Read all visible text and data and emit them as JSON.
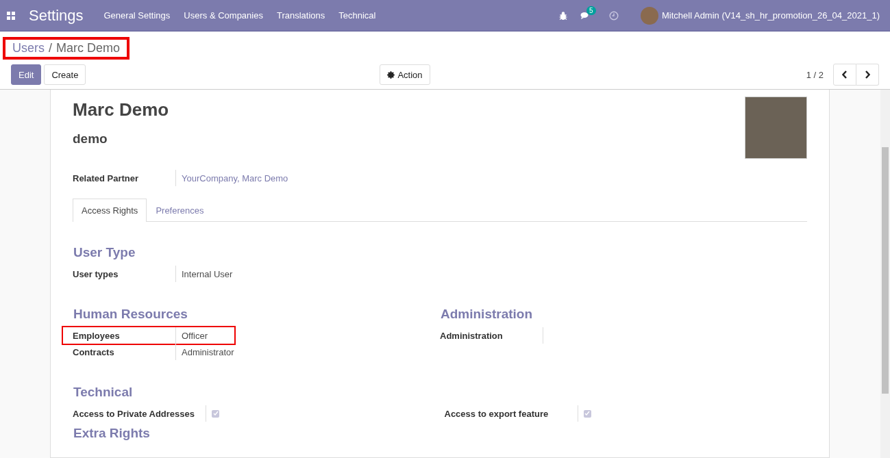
{
  "navbar": {
    "app_name": "Settings",
    "menus": [
      "General Settings",
      "Users & Companies",
      "Translations",
      "Technical"
    ],
    "message_count": "5",
    "user": "Mitchell Admin (V14_sh_hr_promotion_26_04_2021_1)"
  },
  "breadcrumb": {
    "parent": "Users",
    "separator": "/",
    "current": "Marc Demo",
    "highlighted": true
  },
  "buttons": {
    "edit": "Edit",
    "create": "Create",
    "action": "Action"
  },
  "pager": {
    "value": "1 / 2"
  },
  "form": {
    "name": "Marc Demo",
    "login": "demo",
    "related_partner": {
      "label": "Related Partner",
      "value": "YourCompany, Marc Demo"
    },
    "tabs": [
      {
        "label": "Access Rights",
        "selected": true
      },
      {
        "label": "Preferences",
        "selected": false
      }
    ],
    "sections": [
      {
        "groups": [
          {
            "title": "User Type",
            "fields": [
              {
                "label": "User types",
                "kind": "text",
                "value": "Internal User",
                "highlighted": false
              }
            ]
          }
        ]
      },
      {
        "groups": [
          {
            "title": "Human Resources",
            "fields": [
              {
                "label": "Employees",
                "kind": "text",
                "value": "Officer",
                "highlighted": true
              },
              {
                "label": "Contracts",
                "kind": "text",
                "value": "Administrator",
                "highlighted": false
              }
            ]
          },
          {
            "title": "Administration",
            "fields": [
              {
                "label": "Administration",
                "kind": "text",
                "highlighted": false
              }
            ]
          }
        ]
      },
      {
        "title": "Technical",
        "groups": [
          {
            "fields": [
              {
                "label": "Access to Private Addresses",
                "kind": "checkbox",
                "checked": true,
                "highlighted": false
              }
            ]
          },
          {
            "fields": [
              {
                "label": "Access to export feature",
                "kind": "checkbox",
                "checked": true,
                "highlighted": false
              }
            ]
          }
        ]
      },
      {
        "title": "Extra Rights"
      }
    ]
  }
}
